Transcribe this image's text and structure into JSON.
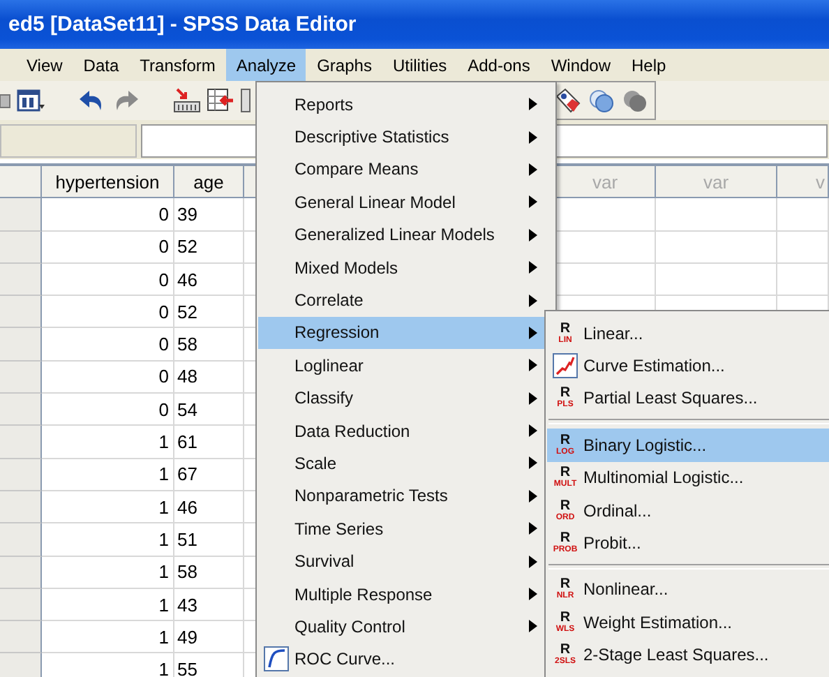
{
  "window": {
    "title": "ed5 [DataSet11] - SPSS Data Editor"
  },
  "menu_bar": [
    {
      "label": "View",
      "selected": false
    },
    {
      "label": "Data",
      "selected": false
    },
    {
      "label": "Transform",
      "selected": false
    },
    {
      "label": "Analyze",
      "selected": true
    },
    {
      "label": "Graphs",
      "selected": false
    },
    {
      "label": "Utilities",
      "selected": false
    },
    {
      "label": "Add-ons",
      "selected": false
    },
    {
      "label": "Window",
      "selected": false
    },
    {
      "label": "Help",
      "selected": false
    }
  ],
  "grid": {
    "columns": [
      {
        "label": "hypertension",
        "kind": "variable"
      },
      {
        "label": "age",
        "kind": "variable"
      },
      {
        "label": "var",
        "kind": "empty"
      },
      {
        "label": "var",
        "kind": "empty"
      },
      {
        "label": "v",
        "kind": "empty"
      }
    ],
    "rows": [
      {
        "hypertension": "0",
        "age": "39"
      },
      {
        "hypertension": "0",
        "age": "52"
      },
      {
        "hypertension": "0",
        "age": "46"
      },
      {
        "hypertension": "0",
        "age": "52"
      },
      {
        "hypertension": "0",
        "age": "58"
      },
      {
        "hypertension": "0",
        "age": "48"
      },
      {
        "hypertension": "0",
        "age": "54"
      },
      {
        "hypertension": "1",
        "age": "61"
      },
      {
        "hypertension": "1",
        "age": "67"
      },
      {
        "hypertension": "1",
        "age": "46"
      },
      {
        "hypertension": "1",
        "age": "51"
      },
      {
        "hypertension": "1",
        "age": "58"
      },
      {
        "hypertension": "1",
        "age": "43"
      },
      {
        "hypertension": "1",
        "age": "49"
      },
      {
        "hypertension": "1",
        "age": "55"
      }
    ]
  },
  "analyze_menu": [
    {
      "label": "Reports",
      "kind": "submenu",
      "selected": false
    },
    {
      "label": "Descriptive Statistics",
      "kind": "submenu",
      "selected": false
    },
    {
      "label": "Compare Means",
      "kind": "submenu",
      "selected": false
    },
    {
      "label": "General Linear Model",
      "kind": "submenu",
      "selected": false
    },
    {
      "label": "Generalized Linear Models",
      "kind": "submenu",
      "selected": false
    },
    {
      "label": "Mixed Models",
      "kind": "submenu",
      "selected": false
    },
    {
      "label": "Correlate",
      "kind": "submenu",
      "selected": false
    },
    {
      "label": "Regression",
      "kind": "submenu",
      "selected": true
    },
    {
      "label": "Loglinear",
      "kind": "submenu",
      "selected": false
    },
    {
      "label": "Classify",
      "kind": "submenu",
      "selected": false
    },
    {
      "label": "Data Reduction",
      "kind": "submenu",
      "selected": false
    },
    {
      "label": "Scale",
      "kind": "submenu",
      "selected": false
    },
    {
      "label": "Nonparametric Tests",
      "kind": "submenu",
      "selected": false
    },
    {
      "label": "Time Series",
      "kind": "submenu",
      "selected": false
    },
    {
      "label": "Survival",
      "kind": "submenu",
      "selected": false
    },
    {
      "label": "Multiple Response",
      "kind": "submenu",
      "selected": false
    },
    {
      "label": "Quality Control",
      "kind": "submenu",
      "selected": false
    },
    {
      "label": "ROC Curve...",
      "kind": "roc",
      "selected": false
    }
  ],
  "regression_submenu": [
    [
      {
        "label": "Linear...",
        "kind": "badge",
        "letter": "R",
        "code": "LIN",
        "selected": false
      },
      {
        "label": "Curve Estimation...",
        "kind": "curve",
        "selected": false
      },
      {
        "label": "Partial Least Squares...",
        "kind": "badge",
        "letter": "R",
        "code": "PLS",
        "selected": false
      }
    ],
    [
      {
        "label": "Binary Logistic...",
        "kind": "badge",
        "letter": "R",
        "code": "LOG",
        "selected": true
      },
      {
        "label": "Multinomial Logistic...",
        "kind": "badge",
        "letter": "R",
        "code": "MULT",
        "selected": false
      },
      {
        "label": "Ordinal...",
        "kind": "badge",
        "letter": "R",
        "code": "ORD",
        "selected": false
      },
      {
        "label": "Probit...",
        "kind": "badge",
        "letter": "R",
        "code": "PROB",
        "selected": false
      }
    ],
    [
      {
        "label": "Nonlinear...",
        "kind": "badge",
        "letter": "R",
        "code": "NLR",
        "selected": false
      },
      {
        "label": "Weight Estimation...",
        "kind": "badge",
        "letter": "R",
        "code": "WLS",
        "selected": false
      },
      {
        "label": "2-Stage Least Squares...",
        "kind": "badge",
        "letter": "R",
        "code": "2SLS",
        "selected": false
      }
    ]
  ]
}
